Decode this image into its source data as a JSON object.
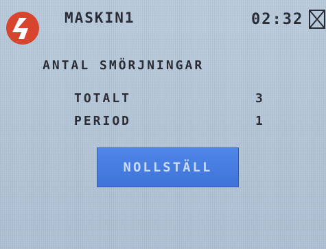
{
  "header": {
    "machine_name": "MASKIN1",
    "time": "02:32",
    "logo_icon": "brand-logo-icon",
    "close_icon": "close-icon"
  },
  "main": {
    "title": "ANTAL SMÖRJNINGAR",
    "rows": [
      {
        "label": "TOTALT",
        "value": "3"
      },
      {
        "label": "PERIOD",
        "value": "1"
      }
    ],
    "reset_button_label": "NOLLSTÄLL"
  },
  "colors": {
    "background": "#b3c5d7",
    "text": "#2a2d36",
    "button": "#4a7ee2",
    "button_text": "#c9dcf7",
    "logo_red": "#d8452e"
  }
}
